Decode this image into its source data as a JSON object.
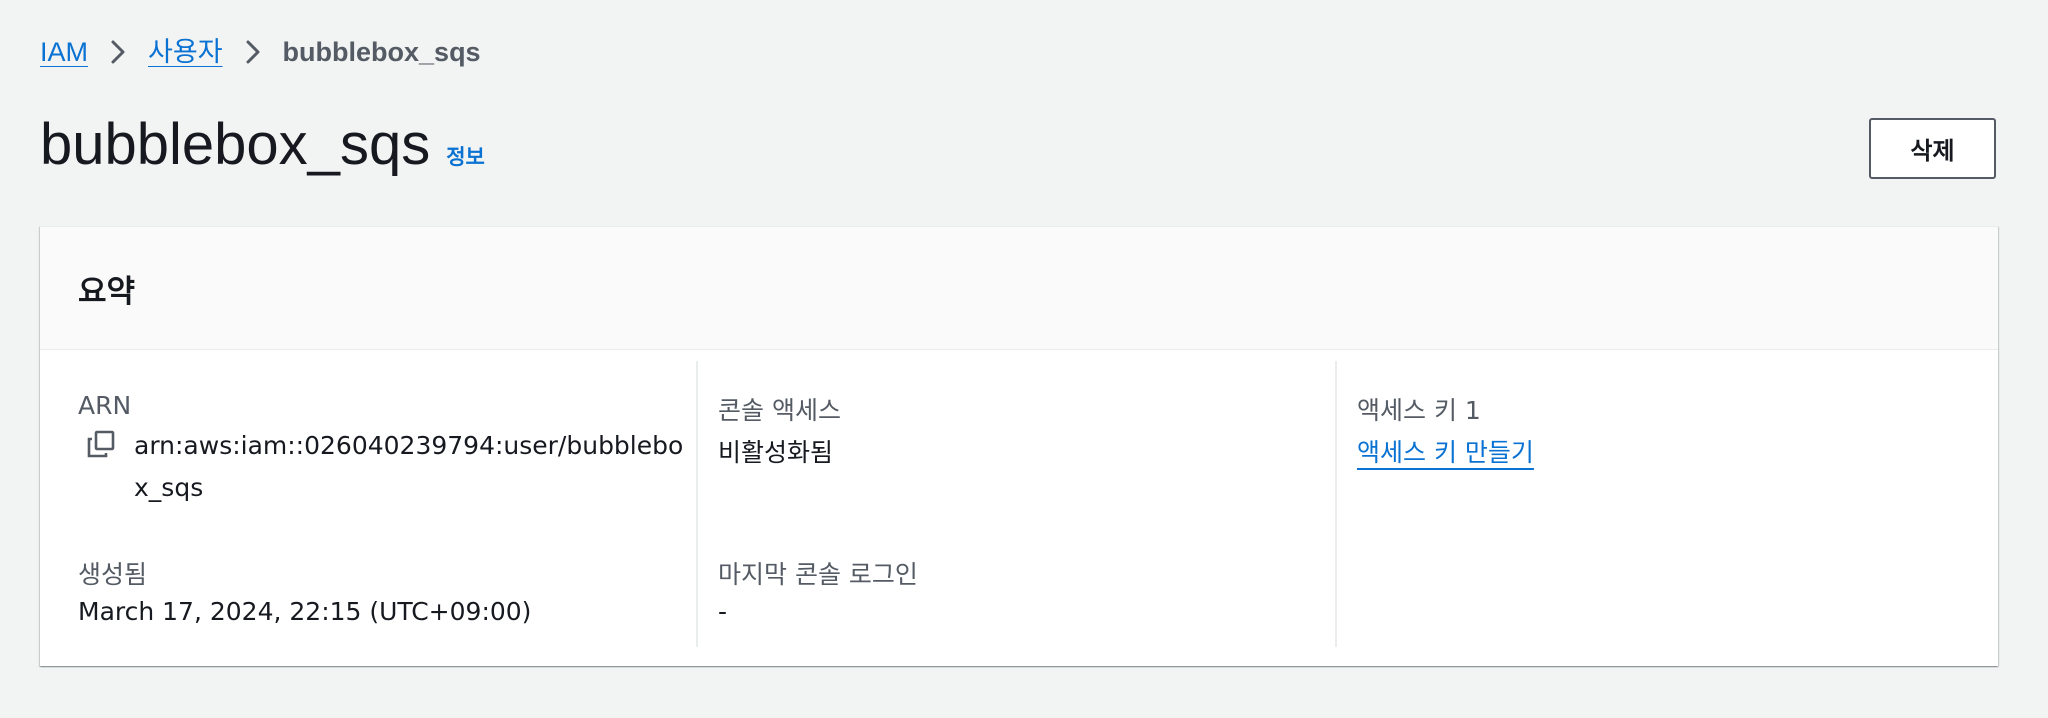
{
  "breadcrumb": {
    "items": [
      "IAM",
      "사용자"
    ],
    "current": "bubblebox_sqs"
  },
  "header": {
    "title": "bubblebox_sqs",
    "info_label": "정보",
    "delete_label": "삭제"
  },
  "summary": {
    "title": "요약",
    "arn": {
      "label": "ARN",
      "value": "arn:aws:iam::026040239794:user/bubblebox_sqs"
    },
    "created": {
      "label": "생성됨",
      "value": "March 17, 2024, 22:15 (UTC+09:00)"
    },
    "console_access": {
      "label": "콘솔 액세스",
      "value": "비활성화됨"
    },
    "last_console_login": {
      "label": "마지막 콘솔 로그인",
      "value": "-"
    },
    "access_key": {
      "label": "액세스 키 1",
      "link": "액세스 키 만들기"
    }
  },
  "colors": {
    "link": "#0972d3",
    "text": "#16191f",
    "muted": "#545b64",
    "background": "#f2f3f3"
  },
  "icons": {
    "breadcrumb_separator": "chevron-right-icon",
    "copy": "copy-icon"
  }
}
